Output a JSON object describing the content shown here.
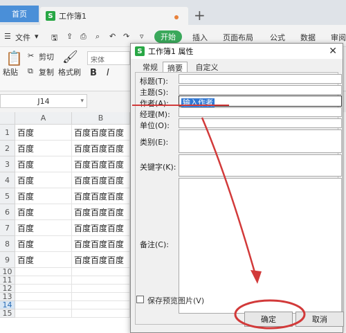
{
  "tabs": {
    "home": "首页",
    "doc": "工作簿1"
  },
  "menu": {
    "file": "文件",
    "start": "开始",
    "items": [
      "插入",
      "页面布局",
      "公式",
      "数据",
      "审阅"
    ]
  },
  "ribbon": {
    "cut": "剪切",
    "paste": "粘贴",
    "copy": "复制",
    "format_painter": "格式刷",
    "font": "宋体",
    "bold": "B",
    "italic": "I"
  },
  "formula_bar": {
    "cell_ref": "J14"
  },
  "sheet": {
    "columns": [
      "A",
      "B"
    ],
    "rows": [
      "1",
      "2",
      "3",
      "4",
      "5",
      "6",
      "7",
      "8",
      "9",
      "10",
      "11",
      "12",
      "13",
      "14",
      "15"
    ],
    "col_a": [
      "百度",
      "百度",
      "百度",
      "百度",
      "百度",
      "百度",
      "百度",
      "百度",
      "百度"
    ],
    "col_b": [
      "百度百度百度",
      "百度百度百度",
      "百度百度百度",
      "百度百度百度",
      "百度百度百度",
      "百度百度百度",
      "百度百度百度",
      "百度百度百度",
      "百度百度百度"
    ]
  },
  "dialog": {
    "title": "工作簿1 属性",
    "tabs": [
      "常规",
      "摘要",
      "自定义"
    ],
    "fields": {
      "title": "标题(T):",
      "subject": "主题(S):",
      "author": "作者(A):",
      "manager": "经理(M):",
      "company": "单位(O):",
      "category": "类别(E):",
      "keywords": "关键字(K):",
      "comments": "备注(C):"
    },
    "author_value": "输入作者",
    "save_preview": "保存预览图片(V)",
    "ok": "确定",
    "cancel": "取消"
  },
  "accent": {
    "red": "#d23a3a",
    "green": "#3aa85b",
    "blue": "#4a8fd8"
  }
}
